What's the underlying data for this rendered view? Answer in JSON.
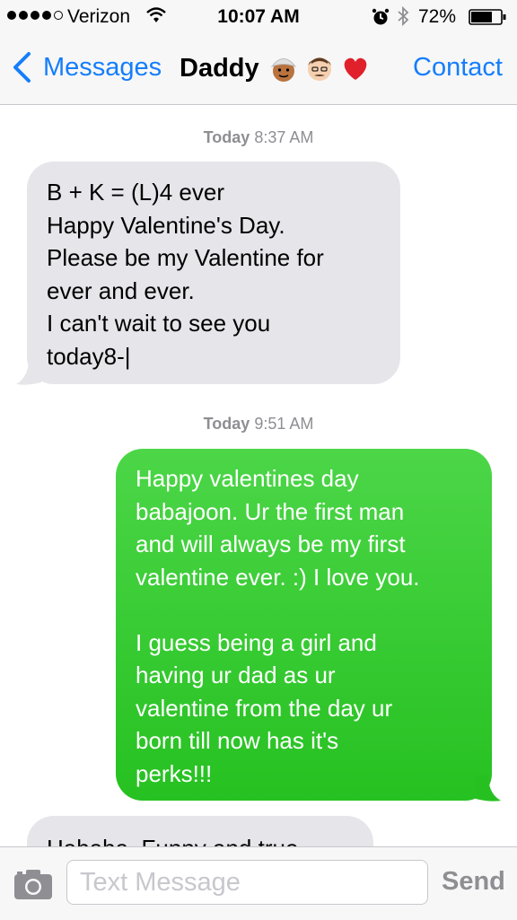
{
  "status_bar": {
    "carrier": "Verizon",
    "time": "10:07 AM",
    "battery": "72%",
    "battery_level": 0.72,
    "signal_bars": 4,
    "icons": [
      "wifi-icon",
      "alarm-icon",
      "bluetooth-icon",
      "battery-icon"
    ]
  },
  "nav": {
    "back_label": "Messages",
    "title": "Daddy",
    "title_emoji": [
      "man-with-turban-emoji",
      "older-man-emoji",
      "red-heart-emoji"
    ],
    "contact_label": "Contact"
  },
  "thread": {
    "timestamp_1": {
      "day": "Today",
      "time": "8:37 AM"
    },
    "message_1": "B + K = (L)4 ever\nHappy Valentine's Day.\nPlease be my Valentine for\never and ever.\nI can't wait to see you\ntoday8-|",
    "timestamp_2": {
      "day": "Today",
      "time": "9:51 AM"
    },
    "message_2": "Happy valentines day\nbabajoon. Ur the first man\nand will always be my first\nvalentine ever. :) I love you.\n\nI guess being a girl and\nhaving ur dad as ur\nvalentine from the day ur\nborn till now has it's\nperks!!!",
    "message_3": "Hahaha. Funny and true."
  },
  "input": {
    "placeholder": "Text Message",
    "send_label": "Send"
  },
  "colors": {
    "accent": "#157efb",
    "incoming_bubble": "#e5e5ea",
    "outgoing_bubble": "#2dc82f",
    "timestamp_text": "#8e8e93"
  }
}
